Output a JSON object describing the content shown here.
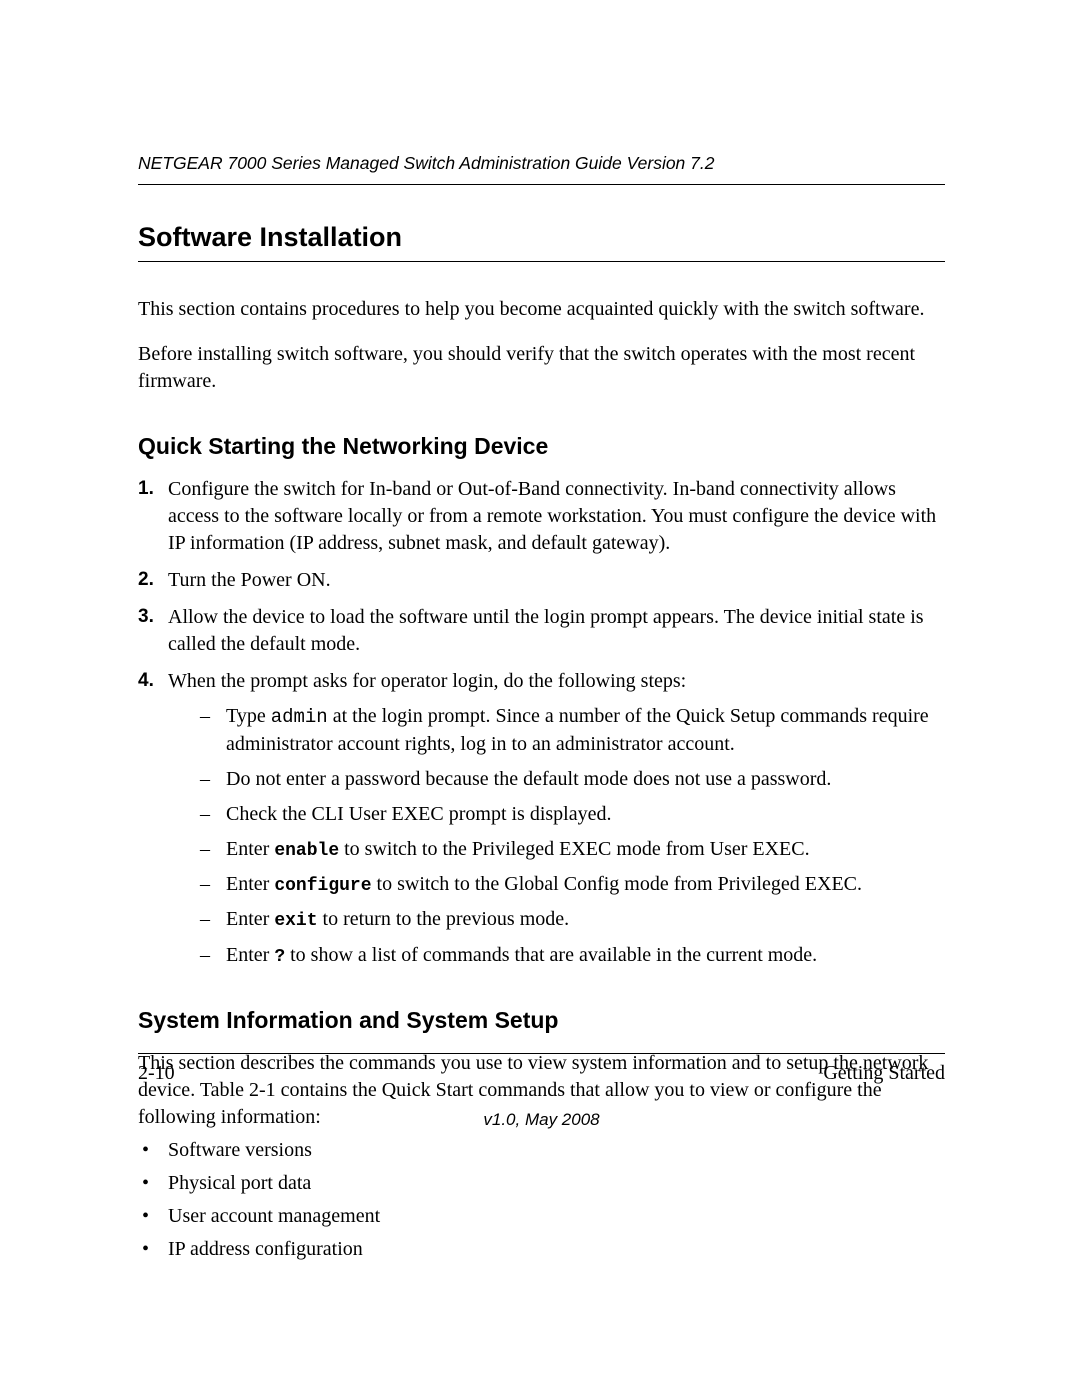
{
  "header": {
    "running_head": "NETGEAR 7000 Series Managed Switch Administration Guide Version 7.2"
  },
  "section": {
    "title": "Software Installation",
    "intro_1": "This section contains procedures to help you become acquainted quickly with the switch software.",
    "intro_2": "Before installing switch software, you should verify that the switch operates with the most recent firmware."
  },
  "quickstart": {
    "title": "Quick Starting the Networking Device",
    "steps": {
      "s1": {
        "marker": "1.",
        "text": "Configure the switch for In-band or Out-of-Band connectivity. In-band connectivity allows access to the software locally or from a remote workstation. You must configure the device with IP information (IP address, subnet mask, and default gateway)."
      },
      "s2": {
        "marker": "2.",
        "text": "Turn the Power ON."
      },
      "s3": {
        "marker": "3.",
        "text": "Allow the device to load the software until the login prompt appears. The device initial state is called the default mode."
      },
      "s4": {
        "marker": "4.",
        "text": "When the prompt asks for operator login, do the following steps:"
      }
    },
    "sub": {
      "a_pre": "Type ",
      "a_cmd": "admin",
      "a_post": " at the login prompt. Since a number of the Quick Setup commands require administrator account rights, log in to an administrator account.",
      "b": "Do not enter a password because the default mode does not use a password.",
      "c": "Check the CLI User EXEC prompt is displayed.",
      "d_pre": "Enter ",
      "d_cmd": "enable",
      "d_post": " to switch to the Privileged EXEC mode from User EXEC.",
      "e_pre": "Enter ",
      "e_cmd": "configure",
      "e_post": " to switch to the Global Config mode from Privileged EXEC.",
      "f_pre": "Enter ",
      "f_cmd": "exit",
      "f_post": " to return to the previous mode.",
      "g_pre": "Enter ",
      "g_cmd": "?",
      "g_post": " to show a list of commands that are available in the current mode."
    }
  },
  "sysinfo": {
    "title": "System Information and System Setup",
    "intro": "This section describes the commands you use to view system information and to setup the network device. Table 2-1 contains the Quick Start commands that allow you to view or configure the following information:",
    "bullets": {
      "b1": "Software versions",
      "b2": "Physical port data",
      "b3": "User account management",
      "b4": "IP address configuration"
    }
  },
  "footer": {
    "page_num": "2-10",
    "section_name": "Getting Started",
    "version_line": "v1.0, May 2008"
  }
}
